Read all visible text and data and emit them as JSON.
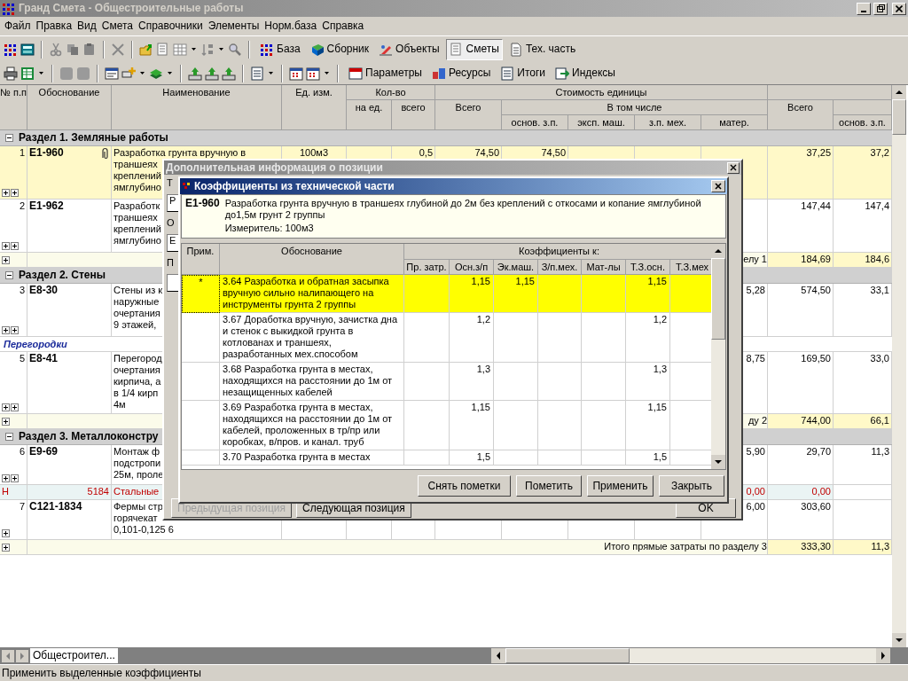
{
  "window": {
    "title": "Гранд Смета - Общестроительные работы"
  },
  "menu": [
    "Файл",
    "Правка",
    "Вид",
    "Смета",
    "Справочники",
    "Элементы",
    "Норм.база",
    "Справка"
  ],
  "toolbar_1": {
    "buttons": [
      {
        "label": "База",
        "selected": false
      },
      {
        "label": "Сборник",
        "selected": false
      },
      {
        "label": "Объекты",
        "selected": false
      },
      {
        "label": "Сметы",
        "selected": true
      },
      {
        "label": "Тех. часть",
        "selected": false
      }
    ]
  },
  "toolbar_2": {
    "buttons": [
      {
        "label": "Параметры"
      },
      {
        "label": "Ресурсы"
      },
      {
        "label": "Итоги"
      },
      {
        "label": "Индексы"
      }
    ]
  },
  "table": {
    "header": {
      "num": "№ п.п",
      "basis": "Обоснование",
      "name": "Наименование",
      "unit": "Ед. изм.",
      "qty": "Кол-во",
      "qty_per_unit": "на ед.",
      "qty_total": "всего",
      "unit_cost": "Стоимость единицы",
      "unit_cost_total": "Всего",
      "including": "В том числе",
      "wage": "основ. з.п.",
      "machines": "эксп. маш.",
      "machine_wage": "з.п. мех.",
      "materials": "матер.",
      "total_cost": "Всего",
      "total_wage": "основ. з.п."
    },
    "rows": [
      {
        "kind": "section",
        "expanded": true,
        "text": "Раздел 1. Земляные работы"
      },
      {
        "kind": "item",
        "selected": true,
        "attachment": true,
        "num": "1",
        "code": "Е1-960",
        "name": [
          "Разработка грунта вручную в",
          "траншеях",
          "креплений",
          "ямглубино"
        ],
        "unit": "100м3",
        "qty_total": "0,5",
        "cost_total": "74,50",
        "wage": "74,50",
        "total": "37,25",
        "total_wage": "37,2",
        "expanders": [
          {
            "expanded": false
          },
          {
            "expanded": false
          }
        ]
      },
      {
        "kind": "item",
        "selected": false,
        "attachment": false,
        "num": "2",
        "code": "Е1-962",
        "name": [
          "Разработк",
          "траншеях",
          "креплений",
          "ямглубино"
        ],
        "total": "147,44",
        "total_wage": "147,4",
        "expanders": [
          {
            "expanded": false
          },
          {
            "expanded": false
          }
        ]
      },
      {
        "kind": "total",
        "expanded": false,
        "text": "елу 1",
        "total": "184,69",
        "total_wage": "184,6"
      },
      {
        "kind": "section",
        "expanded": true,
        "text": "Раздел 2. Стены"
      },
      {
        "kind": "item",
        "selected": false,
        "attachment": false,
        "num": "3",
        "code": "Е8-30",
        "name": [
          "Стены из к",
          "наружные",
          "очертания",
          "9 этажей,"
        ],
        "materials": "5,28",
        "total": "574,50",
        "total_wage": "33,1",
        "expanders": [
          {
            "expanded": false
          },
          {
            "expanded": false
          }
        ]
      },
      {
        "kind": "subsection",
        "text": "Перегородки"
      },
      {
        "kind": "item",
        "selected": false,
        "attachment": false,
        "num": "5",
        "code": "Е8-41",
        "name": [
          "Перегород",
          "очертания",
          "кирпича, а",
          "в 1/4 кирп",
          "4м"
        ],
        "materials": "8,75",
        "total": "169,50",
        "total_wage": "33,0",
        "expanders": [
          {
            "expanded": false
          },
          {
            "expanded": false
          }
        ]
      },
      {
        "kind": "total",
        "expanded": false,
        "text": "ду 2",
        "total": "744,00",
        "total_wage": "66,1"
      },
      {
        "kind": "section",
        "expanded": true,
        "text": "Раздел 3. Металлоконстру"
      },
      {
        "kind": "item",
        "selected": false,
        "attachment": false,
        "num": "6",
        "code": "Е9-69",
        "name": [
          "Монтаж ф",
          "подстропи",
          "25м, проле"
        ],
        "materials": "5,90",
        "total": "29,70",
        "total_wage": "11,3",
        "expanders": [
          {
            "expanded": false
          },
          {
            "expanded": false
          }
        ]
      },
      {
        "kind": "resource",
        "letter": "Н",
        "code": "5184",
        "name": [
          "Стальные"
        ],
        "materials": "0,00",
        "total": "0,00"
      },
      {
        "kind": "item",
        "selected": false,
        "attachment": false,
        "num": "7",
        "code": "С121-1834",
        "name": [
          "Фермы стр",
          "горячекат",
          "0,101-0,125 6"
        ],
        "materials": "6,00",
        "total": "303,60",
        "expanders": [
          {
            "expanded": false
          }
        ]
      },
      {
        "kind": "total",
        "expanded": false,
        "text": "Итого прямые затраты по разделу 3",
        "total": "333,30",
        "total_wage": "11,3"
      }
    ]
  },
  "info_dialog": {
    "title": "Дополнительная информация о позиции",
    "fragments": [
      {
        "kind": "label",
        "text": "Т"
      },
      {
        "kind": "field",
        "text": "Р"
      },
      {
        "kind": "label",
        "text": "О"
      },
      {
        "kind": "field",
        "text": "Е"
      },
      {
        "kind": "label",
        "text": "П"
      }
    ],
    "buttons": [
      {
        "label": "Предыдущая позиция",
        "disabled": true
      },
      {
        "label": "Следующая позиция",
        "disabled": false
      },
      {
        "label": "OK",
        "disabled": false
      }
    ]
  },
  "coef_dialog": {
    "title": "Коэффициенты из технической части",
    "code": "Е1-960",
    "description": "Разработка грунта вручную в траншеях глубиной до 2м без креплений с откосами и копание ямглубиной до1,5м грунт 2 группы",
    "meter": "Измеритель: 100м3",
    "columns": {
      "note": "Прим.",
      "basis": "Обоснование",
      "group": "Коэффициенты к:",
      "items": [
        "Пр. затр.",
        "Осн.з/п",
        "Эк.маш.",
        "З/п.мех.",
        "Мат-лы",
        "Т.З.осн.",
        "Т.З.мех"
      ]
    },
    "rows": [
      {
        "selected": true,
        "note": "*",
        "basis": "3.64 Разработка и обратная засыпка вручную сильно налипающего на инструменты грунта 2 группы",
        "wage": "1,15",
        "machines": "1,15",
        "labor_wage": "1,15"
      },
      {
        "selected": false,
        "basis": "3.67 Доработка вручную, зачистка дна и стенок с выкидкой грунта в котлованах и траншеях, разработанных мех.способом",
        "wage": "1,2",
        "labor_wage": "1,2"
      },
      {
        "selected": false,
        "basis": "3.68 Разработка грунта в местах, находящихся на расстоянии до 1м от незащищенных кабелей",
        "wage": "1,3",
        "labor_wage": "1,3"
      },
      {
        "selected": false,
        "basis": "3.69 Разработка грунта в местах, находящихся на расстоянии до 1м от кабелей, проложенных в тр/пр или коробках, в/пров. и канал. труб",
        "wage": "1,15",
        "labor_wage": "1,15"
      },
      {
        "selected": false,
        "basis": "3.70 Разработка грунта в местах",
        "wage": "1,5",
        "labor_wage": "1,5"
      }
    ],
    "buttons": [
      "Снять пометки",
      "Пометить",
      "Применить",
      "Закрыть"
    ]
  },
  "sheet_tabs": [
    {
      "label": "Общестроител...",
      "selected": true
    }
  ],
  "status_bar": "Применить выделенные коэффициенты"
}
